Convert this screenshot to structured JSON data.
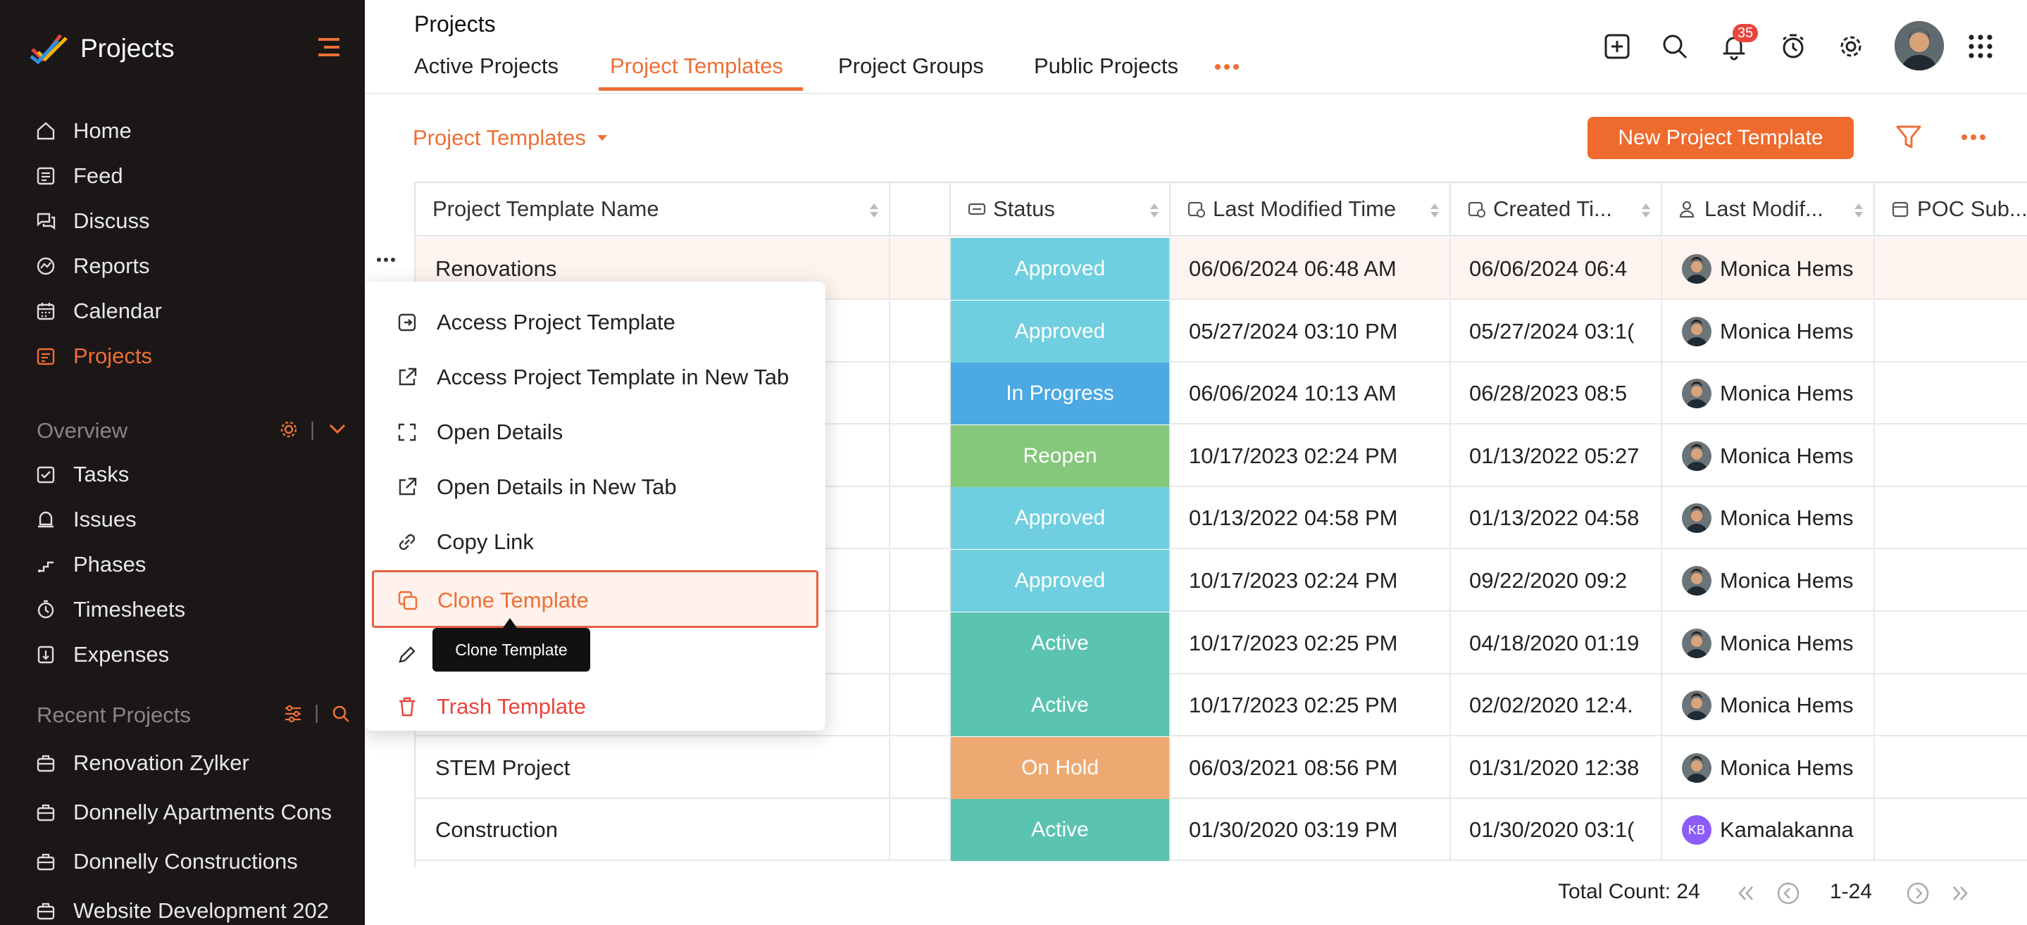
{
  "app": {
    "title": "Projects"
  },
  "sidebar": {
    "items": [
      {
        "label": "Home",
        "icon": "home-icon"
      },
      {
        "label": "Feed",
        "icon": "feed-icon"
      },
      {
        "label": "Discuss",
        "icon": "discuss-icon"
      },
      {
        "label": "Reports",
        "icon": "reports-icon"
      },
      {
        "label": "Calendar",
        "icon": "calendar-icon"
      },
      {
        "label": "Projects",
        "icon": "projects-icon",
        "active": true
      }
    ],
    "overview_label": "Overview",
    "overview_items": [
      {
        "label": "Tasks",
        "icon": "tasks-icon"
      },
      {
        "label": "Issues",
        "icon": "issues-icon"
      },
      {
        "label": "Phases",
        "icon": "phases-icon"
      },
      {
        "label": "Timesheets",
        "icon": "timesheets-icon"
      },
      {
        "label": "Expenses",
        "icon": "expenses-icon"
      }
    ],
    "recent_label": "Recent Projects",
    "recent_items": [
      {
        "label": "Renovation Zylker"
      },
      {
        "label": "Donnelly Apartments Cons"
      },
      {
        "label": "Donnelly Constructions"
      },
      {
        "label": "Website Development 202"
      }
    ]
  },
  "header": {
    "title": "Projects",
    "tabs": [
      {
        "label": "Active Projects"
      },
      {
        "label": "Project Templates",
        "active": true
      },
      {
        "label": "Project Groups"
      },
      {
        "label": "Public Projects"
      }
    ],
    "notification_count": "35"
  },
  "toolbar": {
    "view_label": "Project Templates",
    "new_button": "New Project Template"
  },
  "table": {
    "columns": [
      {
        "label": "Project Template Name"
      },
      {
        "label": ""
      },
      {
        "label": "Status"
      },
      {
        "label": "Last Modified Time"
      },
      {
        "label": "Created Ti..."
      },
      {
        "label": "Last Modif..."
      },
      {
        "label": "POC Sub..."
      }
    ],
    "rows": [
      {
        "name": "Renovations",
        "status": "Approved",
        "status_color": "#6fcfe0",
        "modified": "06/06/2024 06:48 AM",
        "created": "06/06/2024 06:4",
        "user": "Monica Hems"
      },
      {
        "name": "",
        "status": "Approved",
        "status_color": "#6fcfe0",
        "modified": "05/27/2024 03:10 PM",
        "created": "05/27/2024 03:1(",
        "user": "Monica Hems"
      },
      {
        "name": "",
        "status": "In Progress",
        "status_color": "#4ba9e3",
        "modified": "06/06/2024 10:13 AM",
        "created": "06/28/2023 08:5",
        "user": "Monica Hems"
      },
      {
        "name": "",
        "status": "Reopen",
        "status_color": "#85c77b",
        "modified": "10/17/2023 02:24 PM",
        "created": "01/13/2022 05:27",
        "user": "Monica Hems"
      },
      {
        "name": "",
        "status": "Approved",
        "status_color": "#6fcfe0",
        "modified": "01/13/2022 04:58 PM",
        "created": "01/13/2022 04:58",
        "user": "Monica Hems"
      },
      {
        "name": "",
        "status": "Approved",
        "status_color": "#6fcfe0",
        "modified": "10/17/2023 02:24 PM",
        "created": "09/22/2020 09:2",
        "user": "Monica Hems"
      },
      {
        "name": "",
        "status": "Active",
        "status_color": "#5bc4b1",
        "modified": "10/17/2023 02:25 PM",
        "created": "04/18/2020 01:19",
        "user": "Monica Hems"
      },
      {
        "name": "",
        "status": "Active",
        "status_color": "#5bc4b1",
        "modified": "10/17/2023 02:25 PM",
        "created": "02/02/2020 12:4.",
        "user": "Monica Hems"
      },
      {
        "name": "STEM Project",
        "status": "On Hold",
        "status_color": "#eda972",
        "modified": "06/03/2021 08:56 PM",
        "created": "01/31/2020 12:38",
        "user": "Monica Hems"
      },
      {
        "name": "Construction",
        "status": "Active",
        "status_color": "#5bc4b1",
        "modified": "01/30/2020 03:19 PM",
        "created": "01/30/2020 03:1(",
        "user": "Kamalakanna",
        "initials": "KB"
      }
    ]
  },
  "context_menu": {
    "items": [
      {
        "label": "Access Project Template",
        "icon": "open-template-icon"
      },
      {
        "label": "Access Project Template in New Tab",
        "icon": "new-tab-icon"
      },
      {
        "label": "Open Details",
        "icon": "expand-icon"
      },
      {
        "label": "Open Details in New Tab",
        "icon": "new-tab-icon"
      },
      {
        "label": "Copy Link",
        "icon": "link-icon"
      },
      {
        "label": "Clone Template",
        "icon": "clone-icon",
        "highlighted": true
      },
      {
        "label": "",
        "icon": "edit-icon"
      },
      {
        "label": "Trash Template",
        "icon": "trash-icon",
        "danger": true
      }
    ],
    "tooltip": "Clone Template"
  },
  "footer": {
    "total_label": "Total Count: 24",
    "range": "1-24"
  },
  "colors": {
    "accent": "#ee6f35",
    "sidebar_bg": "#1b1717",
    "danger": "#e8453c"
  }
}
